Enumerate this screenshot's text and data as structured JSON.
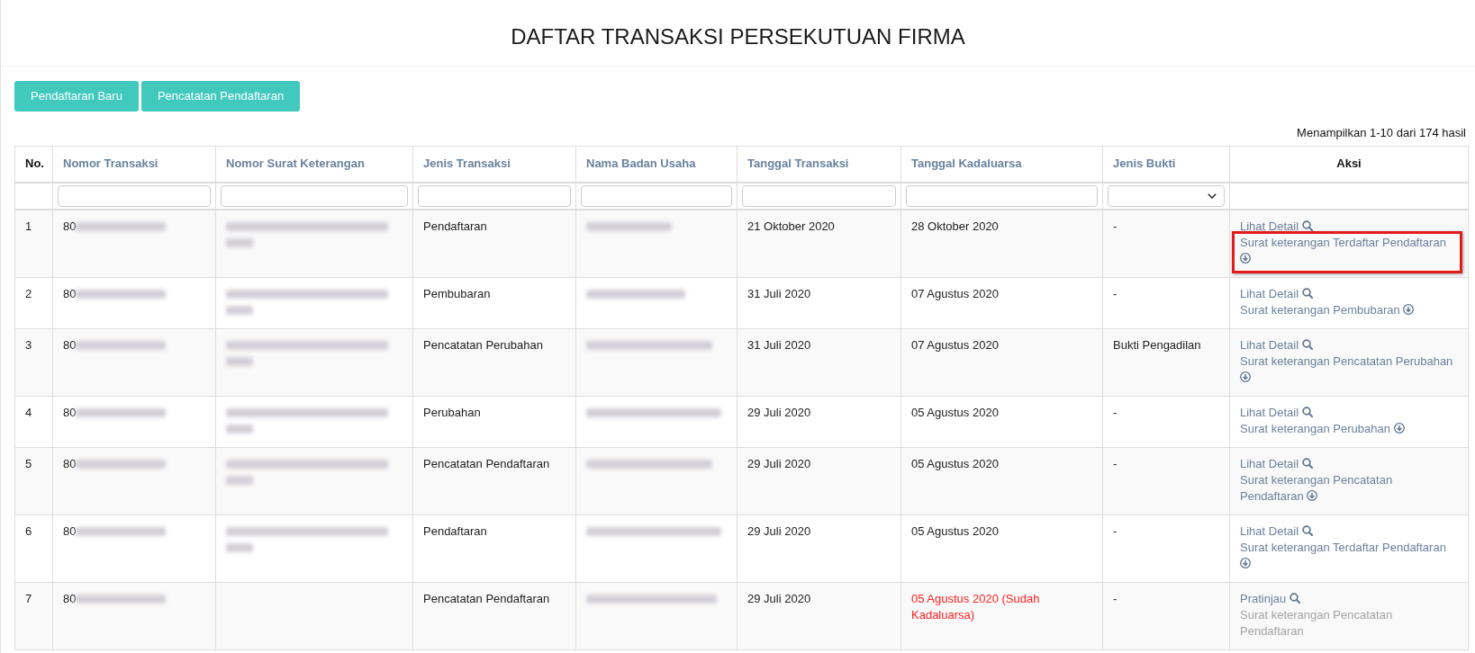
{
  "title": "DAFTAR TRANSAKSI PERSEKUTUAN FIRMA",
  "buttons": [
    {
      "label": "Pendaftaran Baru"
    },
    {
      "label": "Pencatatan Pendaftaran"
    }
  ],
  "result_summary": "Menampilkan 1-10 dari 174 hasil",
  "table": {
    "columns": [
      {
        "label": "No.",
        "sortable": false,
        "kind": "index"
      },
      {
        "label": "Nomor Transaksi",
        "sortable": true,
        "kind": "text"
      },
      {
        "label": "Nomor Surat Keterangan",
        "sortable": true,
        "kind": "text"
      },
      {
        "label": "Jenis Transaksi",
        "sortable": true,
        "kind": "text"
      },
      {
        "label": "Nama Badan Usaha",
        "sortable": true,
        "kind": "text"
      },
      {
        "label": "Tanggal Transaksi",
        "sortable": true,
        "kind": "text"
      },
      {
        "label": "Tanggal Kadaluarsa",
        "sortable": true,
        "kind": "text"
      },
      {
        "label": "Jenis Bukti",
        "sortable": true,
        "kind": "select"
      },
      {
        "label": "Aksi",
        "sortable": false,
        "kind": "actions"
      }
    ],
    "rows": [
      {
        "no": "1",
        "nomor_transaksi": "80",
        "nomor_transaksi_redacted": true,
        "nomor_surat_redacted": true,
        "jenis_transaksi": "Pendaftaran",
        "nama_badan_usaha_redacted": true,
        "tanggal_transaksi": "21 Oktober 2020",
        "tanggal_kadaluarsa": "28 Oktober 2020",
        "expired": false,
        "jenis_bukti": "-",
        "actions": [
          {
            "kind": "view",
            "label": "Lihat Detail",
            "disabled": false,
            "highlighted": false
          },
          {
            "kind": "download",
            "label": "Surat keterangan Terdaftar Pendaftaran",
            "disabled": false,
            "highlighted": true
          }
        ]
      },
      {
        "no": "2",
        "nomor_transaksi": "80",
        "nomor_transaksi_redacted": true,
        "nomor_surat_redacted": true,
        "jenis_transaksi": "Pembubaran",
        "nama_badan_usaha_redacted": true,
        "tanggal_transaksi": "31 Juli 2020",
        "tanggal_kadaluarsa": "07 Agustus 2020",
        "expired": false,
        "jenis_bukti": "-",
        "actions": [
          {
            "kind": "view",
            "label": "Lihat Detail",
            "disabled": false,
            "highlighted": false
          },
          {
            "kind": "download",
            "label": "Surat keterangan Pembubaran",
            "disabled": false,
            "highlighted": false
          }
        ]
      },
      {
        "no": "3",
        "nomor_transaksi": "80",
        "nomor_transaksi_redacted": true,
        "nomor_surat_redacted": true,
        "jenis_transaksi": "Pencatatan Perubahan",
        "nama_badan_usaha_redacted": true,
        "tanggal_transaksi": "31 Juli 2020",
        "tanggal_kadaluarsa": "07 Agustus 2020",
        "expired": false,
        "jenis_bukti": "Bukti Pengadilan",
        "actions": [
          {
            "kind": "view",
            "label": "Lihat Detail",
            "disabled": false,
            "highlighted": false
          },
          {
            "kind": "download",
            "label": "Surat keterangan Pencatatan Perubahan",
            "disabled": false,
            "highlighted": false
          }
        ]
      },
      {
        "no": "4",
        "nomor_transaksi": "80",
        "nomor_transaksi_redacted": true,
        "nomor_surat_redacted": true,
        "jenis_transaksi": "Perubahan",
        "nama_badan_usaha_redacted": true,
        "tanggal_transaksi": "29 Juli 2020",
        "tanggal_kadaluarsa": "05 Agustus 2020",
        "expired": false,
        "jenis_bukti": "-",
        "actions": [
          {
            "kind": "view",
            "label": "Lihat Detail",
            "disabled": false,
            "highlighted": false
          },
          {
            "kind": "download",
            "label": "Surat keterangan Perubahan",
            "disabled": false,
            "highlighted": false
          }
        ]
      },
      {
        "no": "5",
        "nomor_transaksi": "80",
        "nomor_transaksi_redacted": true,
        "nomor_surat_redacted": true,
        "jenis_transaksi": "Pencatatan Pendaftaran",
        "nama_badan_usaha_redacted": true,
        "tanggal_transaksi": "29 Juli 2020",
        "tanggal_kadaluarsa": "05 Agustus 2020",
        "expired": false,
        "jenis_bukti": "-",
        "actions": [
          {
            "kind": "view",
            "label": "Lihat Detail",
            "disabled": false,
            "highlighted": false
          },
          {
            "kind": "download",
            "label": "Surat keterangan Pencatatan Pendaftaran",
            "disabled": false,
            "highlighted": false
          }
        ]
      },
      {
        "no": "6",
        "nomor_transaksi": "80",
        "nomor_transaksi_redacted": true,
        "nomor_surat_redacted": true,
        "jenis_transaksi": "Pendaftaran",
        "nama_badan_usaha_redacted": true,
        "tanggal_transaksi": "29 Juli 2020",
        "tanggal_kadaluarsa": "05 Agustus 2020",
        "expired": false,
        "jenis_bukti": "-",
        "actions": [
          {
            "kind": "view",
            "label": "Lihat Detail",
            "disabled": false,
            "highlighted": false
          },
          {
            "kind": "download",
            "label": "Surat keterangan Terdaftar Pendaftaran",
            "disabled": false,
            "highlighted": false
          }
        ]
      },
      {
        "no": "7",
        "nomor_transaksi": "80",
        "nomor_transaksi_redacted": true,
        "nomor_surat_redacted": false,
        "jenis_transaksi": "Pencatatan Pendaftaran",
        "nama_badan_usaha_redacted": true,
        "tanggal_transaksi": "29 Juli 2020",
        "tanggal_kadaluarsa": "05 Agustus 2020 (Sudah Kadaluarsa)",
        "expired": true,
        "jenis_bukti": "-",
        "actions": [
          {
            "kind": "view",
            "label": "Pratinjau",
            "disabled": false,
            "highlighted": false
          },
          {
            "kind": "download",
            "label": "Surat keterangan Pencatatan Pendaftaran",
            "disabled": true,
            "highlighted": false
          }
        ]
      }
    ]
  }
}
